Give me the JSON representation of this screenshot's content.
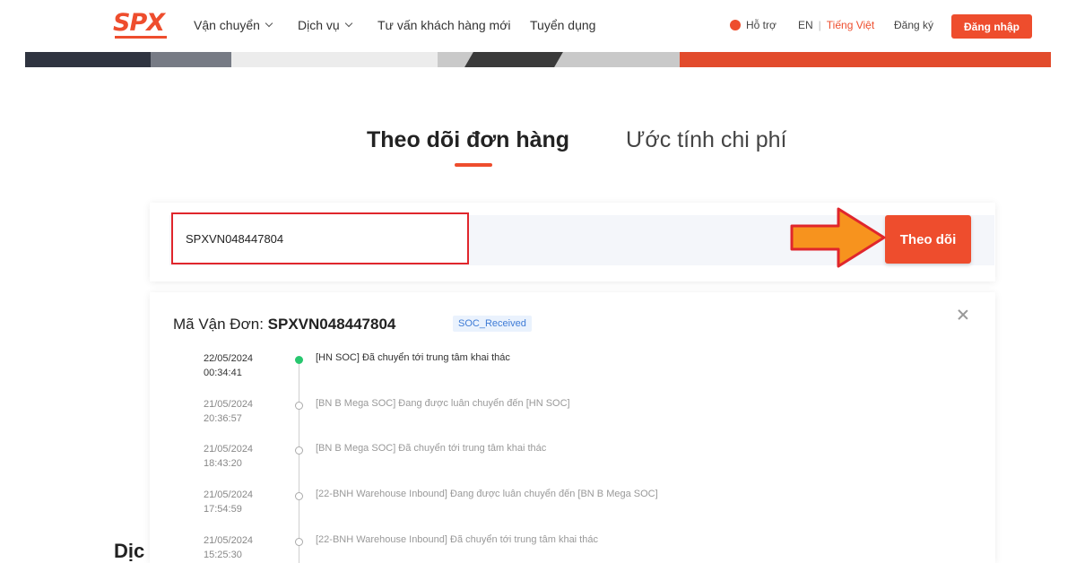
{
  "navbar": {
    "logo": "SPX",
    "items": [
      {
        "label": "Vận chuyển",
        "dropdown": true
      },
      {
        "label": "Dịch vụ",
        "dropdown": true
      },
      {
        "label": "Tư vấn khách hàng mới",
        "dropdown": false
      },
      {
        "label": "Tuyển dụng",
        "dropdown": false
      }
    ],
    "help_label": "Hỗ trợ",
    "lang_en": "EN",
    "lang_separator": "|",
    "lang_vi": "Tiếng Việt",
    "register_label": "Đăng ký",
    "login_label": "Đăng nhập"
  },
  "tabs": {
    "track": "Theo dõi đơn hàng",
    "estimate": "Ước tính chi phí"
  },
  "search": {
    "value": "SPXVN048447804",
    "button_label": "Theo dõi"
  },
  "result": {
    "waybill_label": "Mã Vận Đơn:",
    "waybill_code": "SPXVN048447804",
    "status": "SOC_Received",
    "timeline": [
      {
        "date": "22/05/2024",
        "time": "00:34:41",
        "desc": "[HN SOC] Đã chuyển tới trung tâm khai thác",
        "current": true
      },
      {
        "date": "21/05/2024",
        "time": "20:36:57",
        "desc": "[BN B Mega SOC] Đang được luân chuyển đến [HN SOC]",
        "current": false
      },
      {
        "date": "21/05/2024",
        "time": "18:43:20",
        "desc": "[BN B Mega SOC] Đã chuyển tới trung tâm khai thác",
        "current": false
      },
      {
        "date": "21/05/2024",
        "time": "17:54:59",
        "desc": "[22-BNH Warehouse Inbound] Đang được luân chuyển đến [BN B Mega SOC]",
        "current": false
      },
      {
        "date": "21/05/2024",
        "time": "15:25:30",
        "desc": "[22-BNH Warehouse Inbound] Đã chuyển tới trung tâm khai thác",
        "current": false
      }
    ]
  },
  "bottom_text": "Dịc",
  "colors": {
    "brand": "#ee4d2d",
    "highlight_border": "#e0262c",
    "arrow": "#f7931e",
    "current_dot": "#28c76f"
  }
}
